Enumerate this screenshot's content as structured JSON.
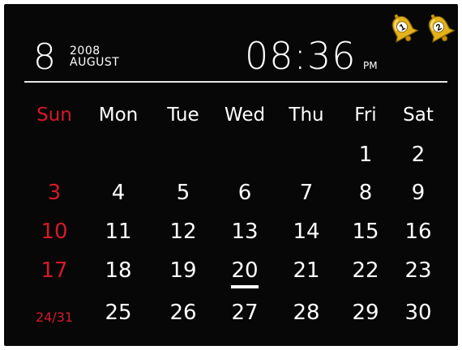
{
  "header": {
    "day": "8",
    "year": "2008",
    "month": "AUGUST",
    "time": "08:36",
    "ampm": "PM"
  },
  "alarms": [
    {
      "label": "1",
      "color": "#e3b21a"
    },
    {
      "label": "2",
      "color": "#e3b21a"
    }
  ],
  "weekdays": [
    "Sun",
    "Mon",
    "Tue",
    "Wed",
    "Thu",
    "Fri",
    "Sat"
  ],
  "weeks": [
    [
      "",
      "",
      "",
      "",
      "",
      "1",
      "2"
    ],
    [
      "3",
      "4",
      "5",
      "6",
      "7",
      "8",
      "9"
    ],
    [
      "10",
      "11",
      "12",
      "13",
      "14",
      "15",
      "16"
    ],
    [
      "17",
      "18",
      "19",
      "20",
      "21",
      "22",
      "23"
    ],
    [
      "24/31",
      "25",
      "26",
      "27",
      "28",
      "29",
      "30"
    ]
  ],
  "today": "20",
  "colors": {
    "background": "#070707",
    "text": "#ffffff",
    "sunday": "#d6182a",
    "bell": "#e3b21a"
  }
}
